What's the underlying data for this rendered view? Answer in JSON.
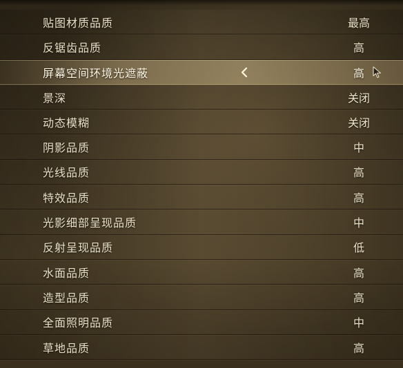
{
  "settings": [
    {
      "label": "贴图材质品质",
      "value": "最高"
    },
    {
      "label": "反锯齿品质",
      "value": "高"
    },
    {
      "label": "屏幕空间环境光遮蔽",
      "value": "高"
    },
    {
      "label": "景深",
      "value": "关闭"
    },
    {
      "label": "动态模糊",
      "value": "关闭"
    },
    {
      "label": "阴影品质",
      "value": "中"
    },
    {
      "label": "光线品质",
      "value": "高"
    },
    {
      "label": "特效品质",
      "value": "高"
    },
    {
      "label": "光影细部呈现品质",
      "value": "中"
    },
    {
      "label": "反射呈现品质",
      "value": "低"
    },
    {
      "label": "水面品质",
      "value": "高"
    },
    {
      "label": "造型品质",
      "value": "高"
    },
    {
      "label": "全面照明品质",
      "value": "中"
    },
    {
      "label": "草地品质",
      "value": "高"
    }
  ],
  "selected_index": 2,
  "icons": {
    "decrease": "chevron-left-icon",
    "pointer": "mouse-cursor-icon"
  },
  "colors": {
    "text": "#ece2c8",
    "highlight": "#c8b487",
    "background": "#3e3321"
  }
}
